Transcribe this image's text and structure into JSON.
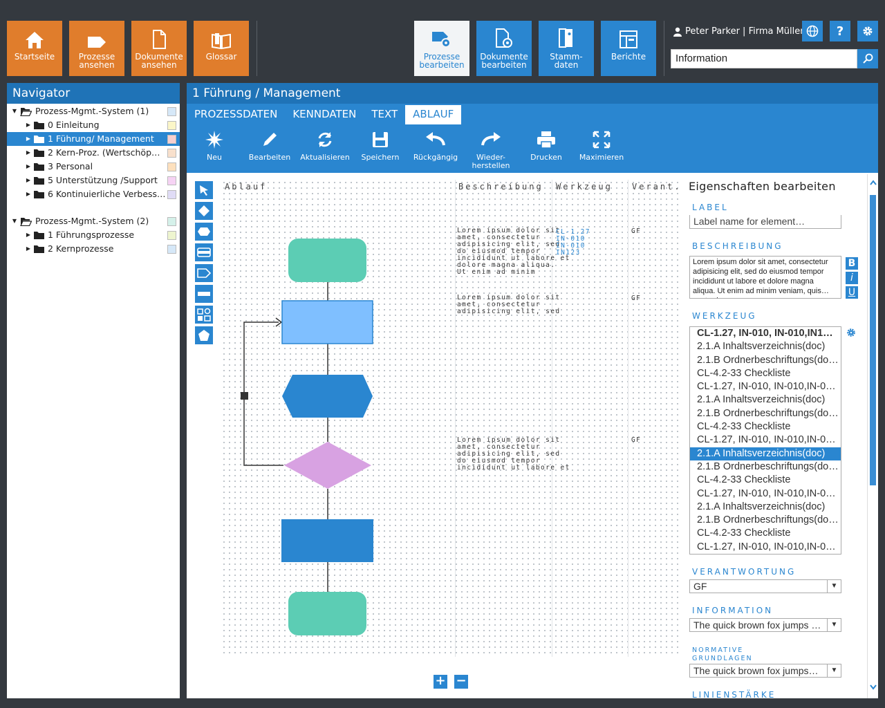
{
  "top_tiles": [
    {
      "label": "Startseite",
      "icon": "home-icon"
    },
    {
      "label": "Prozesse ansehen",
      "icon": "process-tag-icon"
    },
    {
      "label": "Dokumente ansehen",
      "icon": "document-icon"
    },
    {
      "label": "Glossar",
      "icon": "book-icon"
    }
  ],
  "edit_tiles": [
    {
      "label": "Prozesse bearbeiten",
      "icon": "process-edit-icon",
      "active": true
    },
    {
      "label": "Dokumente bearbeiten",
      "icon": "document-edit-icon"
    },
    {
      "label": "Stamm- daten",
      "icon": "master-data-icon"
    },
    {
      "label": "Berichte",
      "icon": "reports-icon"
    }
  ],
  "user": {
    "name": "Peter Parker | Firma Müller"
  },
  "search": {
    "value": "Information"
  },
  "navigator": {
    "title": "Navigator",
    "groups": [
      {
        "label": "Prozess-Mgmt.-System (1)",
        "color": "#d6e8f8",
        "items": [
          {
            "label": "0 Einleitung",
            "color": "#fbf6c8"
          },
          {
            "label": "1 Führung/ Management",
            "color": "#f6cfcf",
            "selected": true
          },
          {
            "label": "2 Kern-Proz. (Wertschöp…",
            "color": "#f8e0cc"
          },
          {
            "label": "3 Personal",
            "color": "#fde0bd"
          },
          {
            "label": "5 Unterstützung /Support",
            "color": "#f6d3f4"
          },
          {
            "label": "6 Kontinuierliche Verbess…",
            "color": "#e0dcf6"
          }
        ]
      },
      {
        "label": "Prozess-Mgmt.-System (2)",
        "color": "#d5f1ea",
        "items": [
          {
            "label": "1 Führungsprozesse",
            "color": "#eef5cf"
          },
          {
            "label": "2 Kernprozesse",
            "color": "#d6e8f8"
          }
        ]
      }
    ]
  },
  "main": {
    "title": "1 Führung / Management",
    "tabs": [
      "PROZESSDATEN",
      "KENNDATEN",
      "TEXT",
      "ABLAUF"
    ],
    "active_tab": "ABLAUF",
    "toolbar": [
      {
        "label": "Neu",
        "icon": "new-star-icon"
      },
      {
        "label": "Bearbeiten",
        "icon": "pencil-icon"
      },
      {
        "label": "Aktualisieren",
        "icon": "refresh-icon"
      },
      {
        "label": "Speichern",
        "icon": "save-icon"
      },
      {
        "label": "Rückgängig",
        "icon": "undo-icon"
      },
      {
        "label": "Wieder-\nherstellen",
        "icon": "redo-icon"
      },
      {
        "label": "Drucken",
        "icon": "print-icon"
      },
      {
        "label": "Maximieren",
        "icon": "maximize-icon"
      }
    ]
  },
  "diagram": {
    "columns": [
      "Ablauf",
      "Beschreibung",
      "Werkzeug",
      "Verant."
    ],
    "rows": [
      {
        "desc": "Lorem ipsum dolor sit\namet, consectetur\nadipisicing elit, sed\ndo eiusmod tempor\nincididunt ut labore et\ndolore magna aliqua.\nUt enim ad minim",
        "tools": "CL-1.27\nIN-010\nIN-010\nIN123",
        "resp": "GF"
      },
      {
        "desc": "Lorem ipsum dolor sit\namet, consectetur\nadipisicing elit, sed",
        "tools": "",
        "resp": "GF"
      },
      {
        "desc": "Lorem ipsum dolor sit\namet, consectetur\nadipisicing elit, sed\ndo eiusmod tempor\nincididunt ut labore et",
        "tools": "",
        "resp": "GF"
      }
    ],
    "colors": {
      "terminal": "#5ccdb4",
      "process_light": "#7fbfff",
      "hexagon": "#2a86d0",
      "decision": "#d8a2e2",
      "process": "#2a86d0"
    }
  },
  "properties": {
    "title": "Eigenschaften bearbeiten",
    "label_label": "LABEL",
    "label_placeholder": "Label name for element…",
    "desc_label": "BESCHREIBUNG",
    "desc_text": "Lorem ipsum dolor sit amet, consectetur adipisicing elit, sed do eiusmod tempor incididunt ut labore et dolore magna aliqua. Ut enim ad minim veniam, quis… nostrud",
    "format_buttons": [
      "B",
      "i",
      "U"
    ],
    "tools_label": "WERKZEUG",
    "tools": [
      "CL-1.27, IN-010, IN-010,IN1…",
      "2.1.A Inhaltsverzeichnis(doc)",
      "2.1.B Ordnerbeschriftungs(do…",
      "CL-4.2-33 Checkliste",
      "CL-1.27, IN-010, IN-010,IN-010…",
      "2.1.A Inhaltsverzeichnis(doc)",
      "2.1.B Ordnerbeschriftungs(do…",
      "CL-4.2-33 Checkliste",
      "CL-1.27, IN-010, IN-010,IN-010…",
      "2.1.A Inhaltsverzeichnis(doc)",
      "2.1.B Ordnerbeschriftungs(do…",
      "CL-4.2-33 Checkliste",
      "CL-1.27, IN-010, IN-010,IN-010…",
      "2.1.A Inhaltsverzeichnis(doc)",
      "2.1.B Ordnerbeschriftungs(do…",
      "CL-4.2-33 Checkliste",
      "CL-1.27, IN-010, IN-010,IN-010…"
    ],
    "tools_selected_index": 9,
    "resp_label": "VERANTWORTUNG",
    "resp_value": "GF",
    "info_label": "INFORMATION",
    "info_value": "The quick brown fox jumps …",
    "norm_label_1": "NORMATIVE",
    "norm_label_2": "GRUNDLAGEN",
    "norm_value": "The quick brown fox jumps…",
    "line_label": "LINIENSTÄRKE"
  }
}
